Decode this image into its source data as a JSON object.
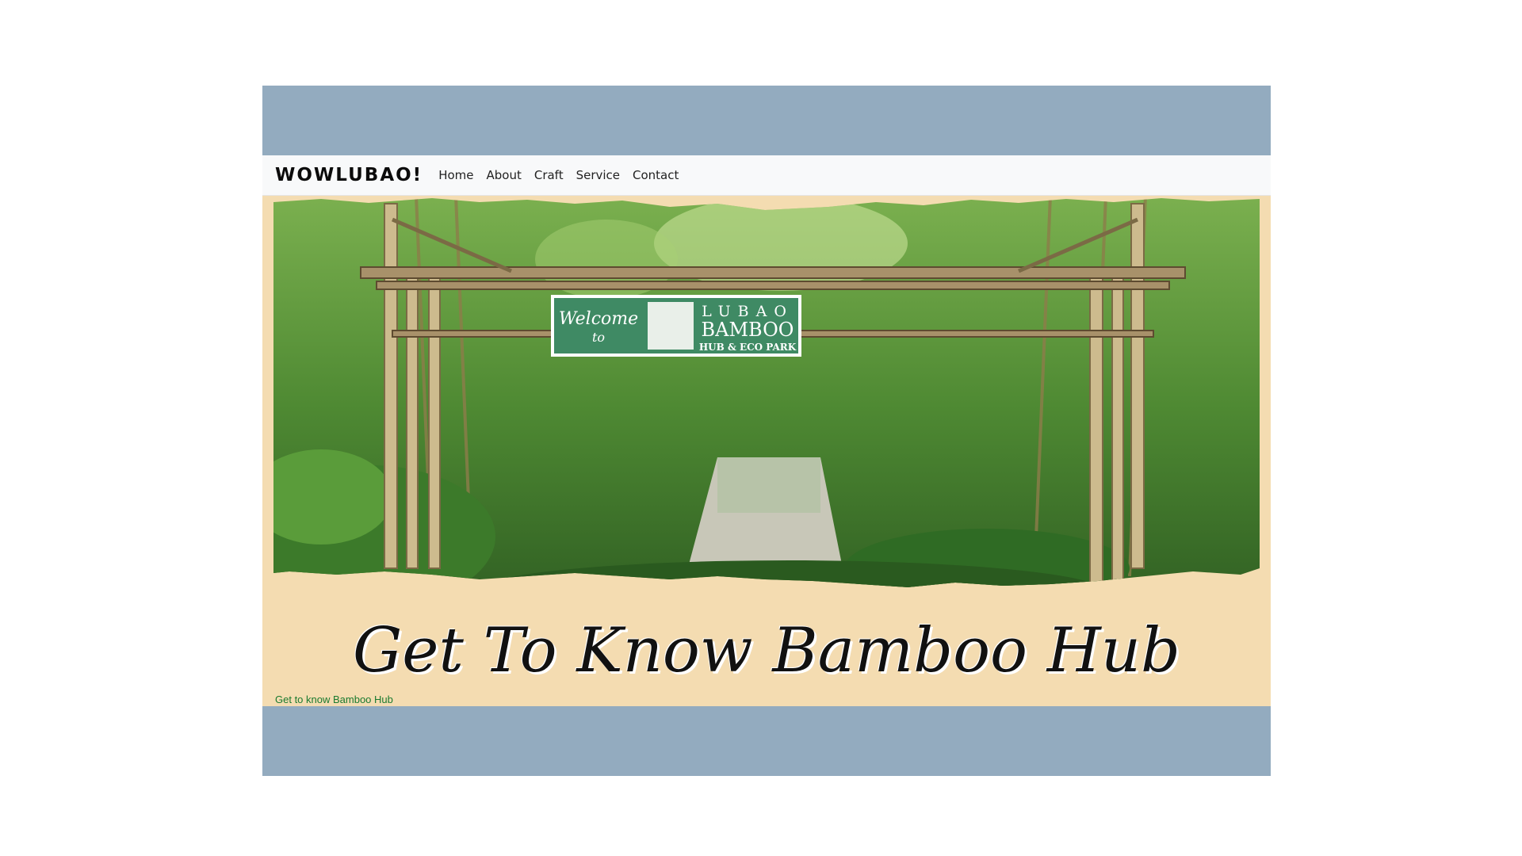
{
  "navbar": {
    "brand": "WOWLUBAO!",
    "links": [
      "Home",
      "About",
      "Craft",
      "Service",
      "Contact"
    ]
  },
  "hero": {
    "sign": {
      "welcome_line1": "Welcome",
      "welcome_line2": "to",
      "line1": "LUBAO",
      "line2": "BAMBOO",
      "line3": "HUB & ECO PARK"
    }
  },
  "headline": "Get To Know Bamboo Hub",
  "subtext": "Get to know Bamboo Hub",
  "colors": {
    "frame_bg": "#93abbf",
    "page_bg": "#f4dcb1",
    "sign_green": "#3f8a64"
  }
}
